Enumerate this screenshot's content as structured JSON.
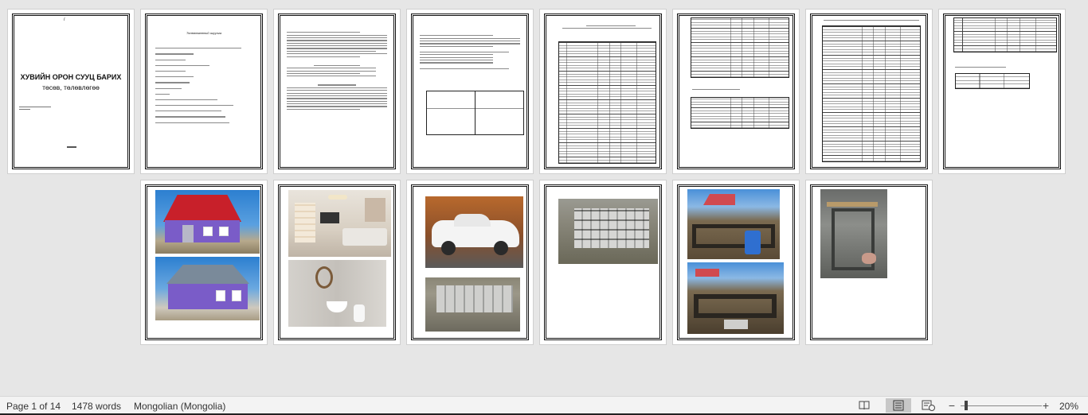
{
  "cover": {
    "top_mark": "/",
    "title_line1": "ХУВИЙН ОРОН СУУЦ БАРИХ",
    "title_line2": "төсөв, төлөвлөгөө"
  },
  "toc": {
    "heading": "Төлөвлөгөөний агуулга"
  },
  "statusbar": {
    "page_info": "Page 1 of 14",
    "word_count": "1478 words",
    "language": "Mongolian (Mongolia)",
    "zoom": "20%",
    "zoom_out_symbol": "−",
    "zoom_in_symbol": "+"
  },
  "colors": {
    "workspace_bg": "#e6e6e6",
    "statusbar_bg": "#f3f3f3",
    "roof_red": "#c8202a",
    "wall_purple": "#7a5cc8",
    "sky_blue": "#2c7fd0"
  },
  "icons": {
    "read_mode": "book-icon",
    "print_layout": "page-icon",
    "web_layout": "web-icon"
  }
}
